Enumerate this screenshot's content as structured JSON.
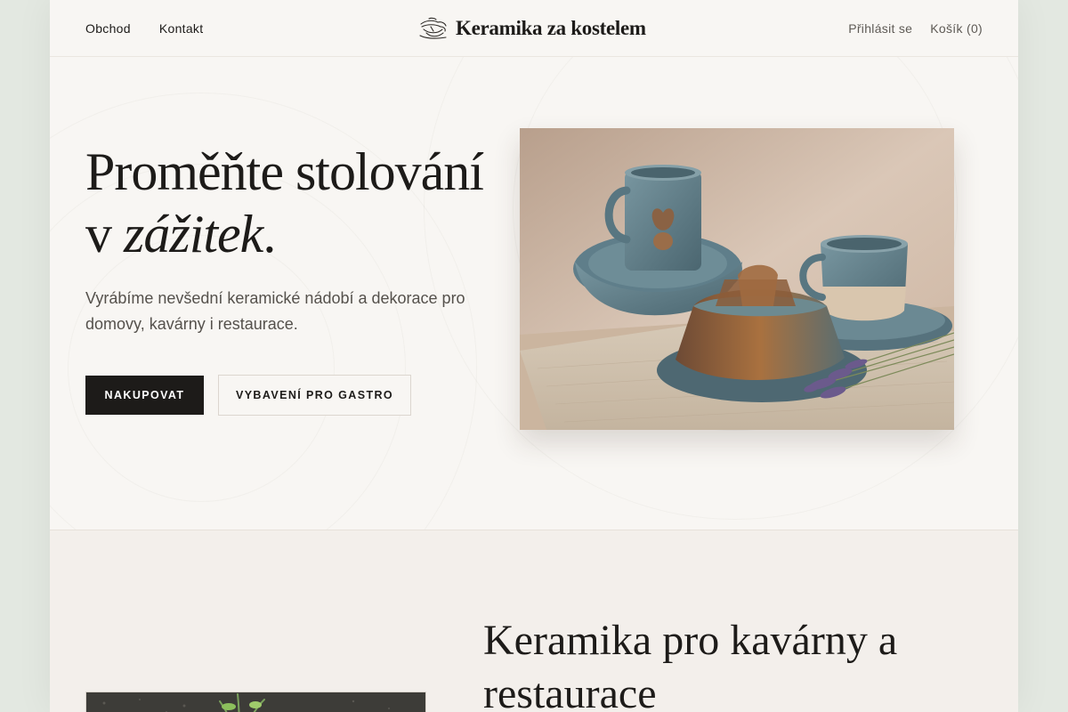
{
  "header": {
    "nav_left": [
      "Obchod",
      "Kontakt"
    ],
    "brand": "Keramika za kostelem",
    "login": "Přihlásit se",
    "cart": "Košík (0)"
  },
  "hero": {
    "title_line1": "Proměňte stolování",
    "title_prefix": "v ",
    "title_emphasis": "zážitek",
    "title_suffix": ".",
    "description": "Vyrábíme nevšední keramické nádobí a dekorace pro domovy, kavárny i restaurace.",
    "primary_button": "NAKUPOVAT",
    "secondary_button": "VYBAVENÍ PRO GASTRO"
  },
  "section2": {
    "title": "Keramika pro kavárny a restaurace"
  },
  "colors": {
    "page_bg": "#e3e8e1",
    "content_bg": "#f8f6f3",
    "section2_bg": "#f3efeb",
    "text_dark": "#1d1b19",
    "text_muted": "#55514c",
    "button_dark": "#1d1b19",
    "ceramic_blue": "#5f7e8a"
  },
  "icons": {
    "brand_logo": "ceramic-vessel-sketch-icon"
  }
}
